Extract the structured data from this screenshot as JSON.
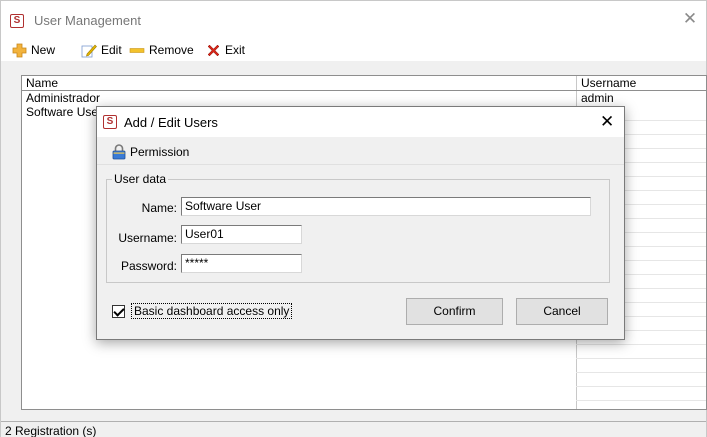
{
  "main_window": {
    "title": "User Management",
    "app_icon_letter": "S",
    "close_glyph": "✕"
  },
  "toolbar": {
    "new_label": "New",
    "edit_label": "Edit",
    "remove_label": "Remove",
    "exit_label": "Exit"
  },
  "grid": {
    "columns": [
      "Name",
      "Username"
    ],
    "rows": [
      {
        "name": "Administrador",
        "username": "admin"
      },
      {
        "name": "Software User",
        "username": ""
      }
    ]
  },
  "status": {
    "text": "2 Registration (s)"
  },
  "dialog": {
    "title": "Add / Edit Users",
    "close_glyph": "✕",
    "permission_label": "Permission",
    "group_title": "User data",
    "name_label": "Name:",
    "name_value": "Software User",
    "username_label": "Username:",
    "username_value": "User01",
    "password_label": "Password:",
    "password_value": "*****",
    "checkbox_label": "Basic dashboard access only",
    "checkbox_checked": true,
    "confirm_label": "Confirm",
    "cancel_label": "Cancel"
  },
  "icons": {
    "app": "app-logo-icon",
    "new": "add-plus-icon",
    "edit": "pencil-edit-icon",
    "remove": "minus-remove-icon",
    "exit": "red-x-exit-icon",
    "permission": "padlock-icon"
  },
  "colors": {
    "new_icon": "#f2b33d",
    "edit_icon": "#e6b800",
    "remove_icon": "#f3c22b",
    "exit_icon": "#d4281b",
    "permission_icon": "#3a7bd5"
  }
}
